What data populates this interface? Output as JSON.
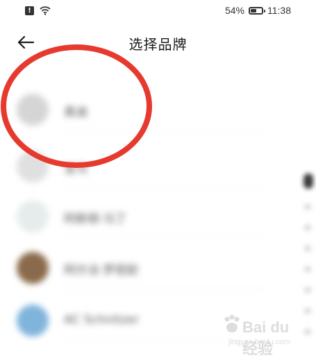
{
  "status_bar": {
    "notification_icon": "alert-badge-icon",
    "wifi_icon": "wifi-icon",
    "battery_percent": "54%",
    "battery_level": 0.54,
    "time": "11:38"
  },
  "nav": {
    "back_icon": "arrow-left-icon",
    "title": "选择品牌"
  },
  "brands": [
    {
      "name": "奥迪",
      "logo_color": "#d5d5d5"
    },
    {
      "name": "宝马",
      "logo_color": "#e0e0e0"
    },
    {
      "name": "阿斯顿·马丁",
      "logo_color": "#e6ebec"
    },
    {
      "name": "阿尔法·罗密欧",
      "logo_color": "#8a6a4a"
    },
    {
      "name": "AC Schnitzer",
      "logo_color": "#7fb4dc"
    }
  ],
  "annotation": {
    "color": "#e63a2e",
    "shape": "ellipse"
  },
  "watermark": {
    "logo_text": "Bai du 经验",
    "url": "jingyan.baidu.com"
  }
}
